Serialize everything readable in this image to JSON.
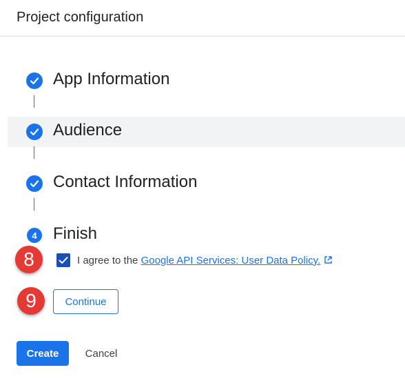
{
  "header": {
    "title": "Project configuration"
  },
  "stepper": {
    "steps": [
      {
        "label": "App Information",
        "status": "completed",
        "icon": "check-icon"
      },
      {
        "label": "Audience",
        "status": "completed",
        "icon": "check-icon",
        "highlighted": true
      },
      {
        "label": "Contact Information",
        "status": "completed",
        "icon": "check-icon"
      },
      {
        "label": "Finish",
        "status": "current",
        "number": "4"
      }
    ]
  },
  "agreement": {
    "checked": true,
    "text_prefix": "I agree to the",
    "link_text": "Google API Services: User Data Policy.",
    "link_icon": "external-link-icon"
  },
  "annotations": {
    "badge_checkbox": "8",
    "badge_continue": "9"
  },
  "buttons": {
    "continue_label": "Continue",
    "create_label": "Create",
    "cancel_label": "Cancel"
  },
  "colors": {
    "accent": "#1a73e8",
    "badge": "#e53935",
    "highlight_row": "#f1f3f4"
  }
}
